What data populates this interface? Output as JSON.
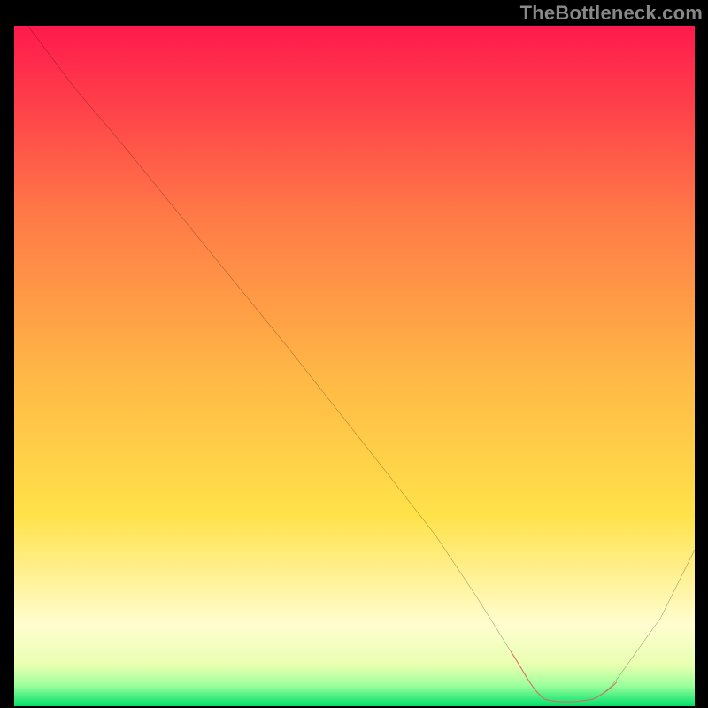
{
  "brand": "TheBottleneck.com",
  "chart_data": {
    "type": "line",
    "title": "",
    "xlabel": "",
    "ylabel": "",
    "xlim": [
      0,
      100
    ],
    "ylim": [
      0,
      100
    ],
    "grid": false,
    "background": {
      "red_top": "#ff1a4d",
      "orange": "#ff7a47",
      "yellow": "#ffe24a",
      "pale": "#fffdcf",
      "green": "#00e06a"
    },
    "series": [
      {
        "name": "curve",
        "x": [
          2,
          8,
          14,
          25,
          40,
          55,
          62,
          68,
          73,
          77,
          78,
          80,
          82,
          85,
          88,
          95,
          100
        ],
        "y": [
          100,
          92,
          86,
          72,
          53,
          34,
          25,
          16,
          8,
          2,
          1,
          0.5,
          0.5,
          1,
          3,
          13,
          23
        ]
      },
      {
        "name": "highlight",
        "x": [
          73,
          77,
          78,
          80,
          82,
          85,
          88
        ],
        "y": [
          8,
          2,
          1,
          0.5,
          0.5,
          1,
          3
        ]
      }
    ],
    "colors": {
      "curve": "#000000",
      "highlight": "#d86a6a"
    }
  }
}
